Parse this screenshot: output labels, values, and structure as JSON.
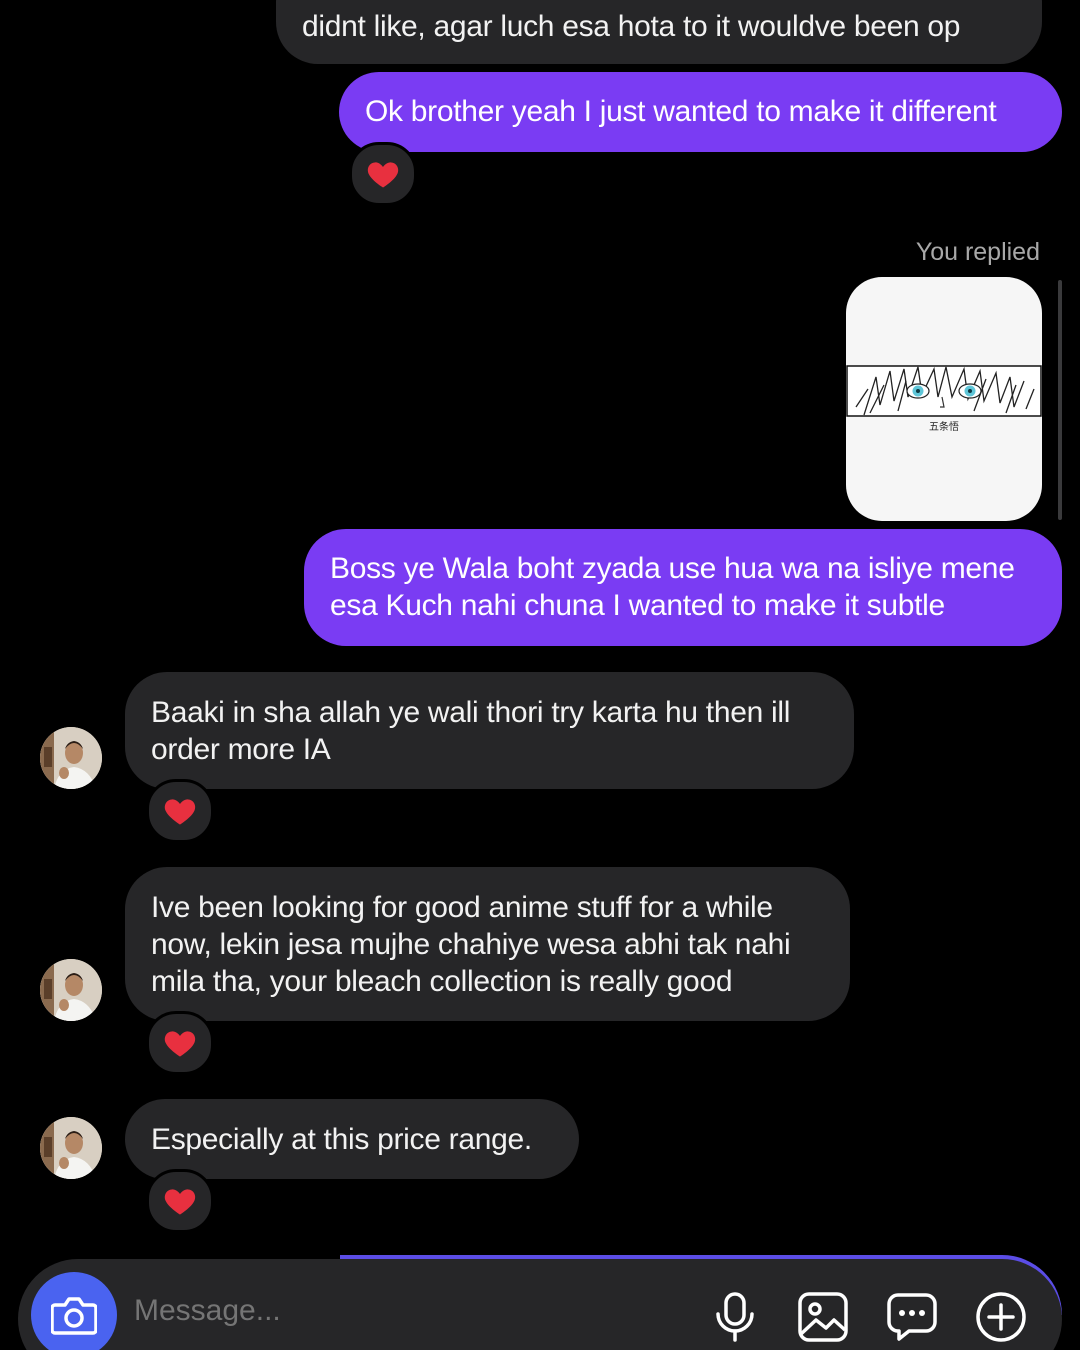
{
  "messages": {
    "m1_partial": "didnt like, agar luch esa hota to it wouldve been op",
    "m2": "Ok brother yeah I just wanted to make it different",
    "reply_label": "You replied",
    "m3_line1": "Boss ye Wala boht zyada use hua wa na isliye mene",
    "m3_line2": "esa Kuch nahi chuna I wanted to make it subtle",
    "m4_line1": "Baaki in sha allah ye wali thori try karta hu then ill",
    "m4_line2": "order more IA",
    "m5_line1": "Ive been looking for good anime stuff for a while",
    "m5_line2": "now, lekin jesa mujhe chahiye wesa abhi tak nahi",
    "m5_line3": "mila tha, your bleach collection is really good",
    "m6": "Especially at this price range."
  },
  "reply_image": {
    "caption": "五条悟"
  },
  "composer": {
    "placeholder": "Message..."
  },
  "colors": {
    "outgoing_bubble": "#7a3cf3",
    "incoming_bubble": "#262628",
    "camera_button": "#4a63f0",
    "heart": "#e8303f"
  },
  "icons": {
    "reaction": "heart-icon",
    "camera": "camera-icon",
    "mic": "microphone-icon",
    "gallery": "gallery-icon",
    "sticker": "chat-bubble-icon",
    "more": "plus-circle-icon"
  }
}
